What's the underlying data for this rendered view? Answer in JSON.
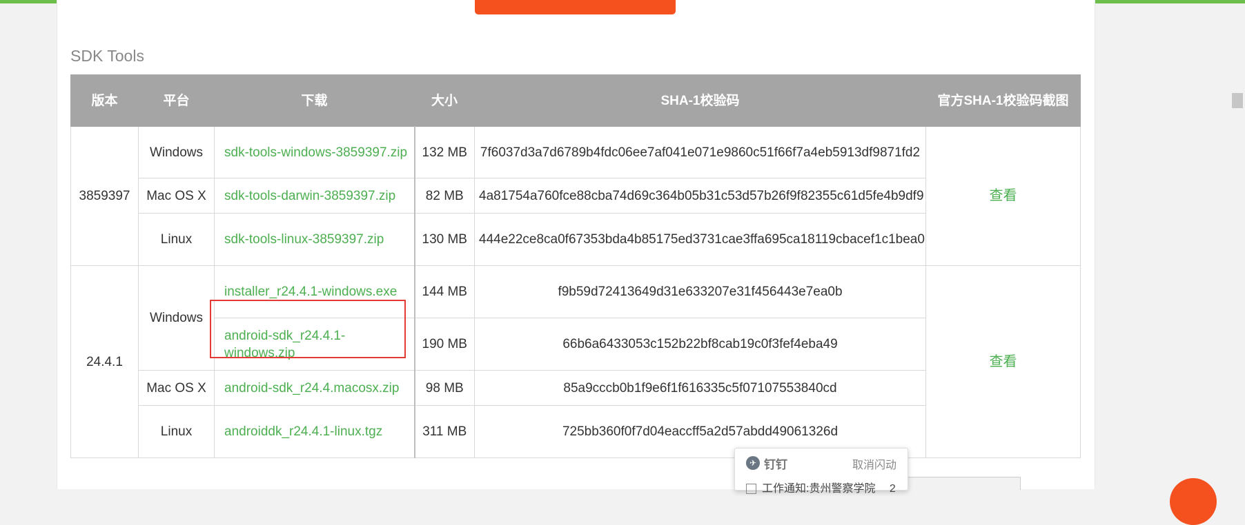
{
  "section_title": "SDK Tools",
  "table": {
    "headers": [
      "版本",
      "平台",
      "下载",
      "大小",
      "SHA-1校验码",
      "官方SHA-1校验码截图"
    ],
    "groups": [
      {
        "version": "3859397",
        "view_label": "查看",
        "rows": [
          {
            "platform": "Windows",
            "file": "sdk-tools-windows-3859397.zip",
            "size": "132 MB",
            "sha1": "7f6037d3a7d6789b4fdc06ee7af041e071e9860c51f66f7a4eb5913df9871fd2"
          },
          {
            "platform": "Mac OS X",
            "file": "sdk-tools-darwin-3859397.zip",
            "size": "82 MB",
            "sha1": "4a81754a760fce88cba74d69c364b05b31c53d57b26f9f82355c61d5fe4b9df9"
          },
          {
            "platform": "Linux",
            "file": "sdk-tools-linux-3859397.zip",
            "size": "130 MB",
            "sha1": "444e22ce8ca0f67353bda4b85175ed3731cae3ffa695ca18119cbacef1c1bea0"
          }
        ]
      },
      {
        "version": "24.4.1",
        "view_label": "查看",
        "rows": [
          {
            "platform": "Windows",
            "file": "installer_r24.4.1-windows.exe",
            "size": "144 MB",
            "sha1": "f9b59d72413649d31e633207e31f456443e7ea0b"
          },
          {
            "platform": "",
            "file": "android-sdk_r24.4.1-windows.zip",
            "size": "190 MB",
            "sha1": "66b6a6433053c152b22bf8cab19c0f3fef4eba49"
          },
          {
            "platform": "Mac OS X",
            "file": "android-sdk_r24.4.macosx.zip",
            "size": "98 MB",
            "sha1": "85a9cccb0b1f9e6f1f616335c5f07107553840cd"
          },
          {
            "platform": "Linux",
            "file": "androiddk_r24.4.1-linux.tgz",
            "size": "311 MB",
            "sha1": "725bb360f0f7d04eaccff5a2d57abdd49061326d"
          }
        ]
      }
    ]
  },
  "notification": {
    "app_name": "钉钉",
    "cancel_label": "取消闪动",
    "message": "工作通知:贵州警察学院",
    "count": "2"
  },
  "colors": {
    "accent": "#4caf50",
    "header_bg": "#a5a5a5",
    "highlight_box": "#e53935",
    "top_bar": "#6cbf4a",
    "orange": "#f4511e"
  }
}
